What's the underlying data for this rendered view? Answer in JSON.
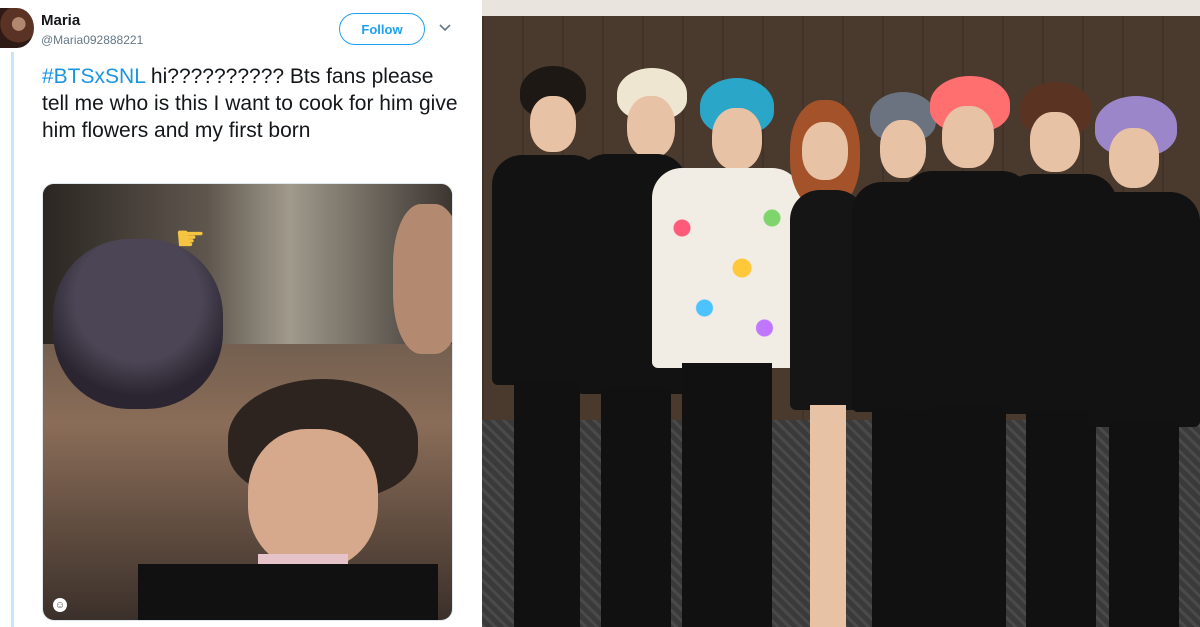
{
  "tweet": {
    "display_name": "Maria",
    "handle": "@Maria092888221",
    "follow_label": "Follow",
    "hashtag": "#BTSxSNL",
    "text": " hi?????????? Bts fans please tell me who is this I want to cook for him give him flowers and my first born"
  },
  "icons": {
    "caret": "chevron-down-icon",
    "pointer": "pointing-hand-icon",
    "gif": "smiley-icon"
  },
  "colors": {
    "accent": "#1da1f2",
    "hashtag": "#1b95e0",
    "thread_line": "#c7e6fb"
  }
}
